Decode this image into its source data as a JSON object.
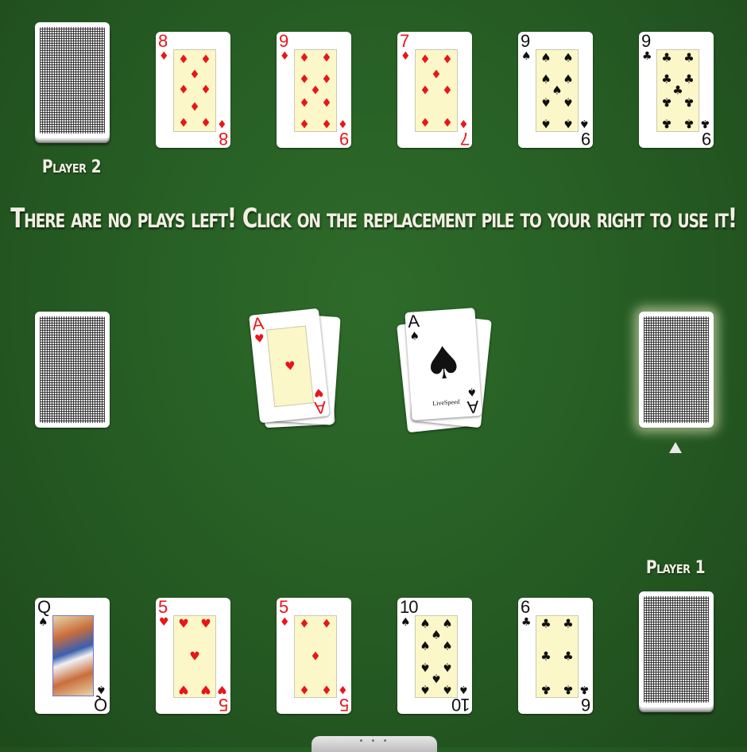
{
  "message": "There are no plays left! Click on the replacement pile to your right to use it!",
  "player2": {
    "label": "Player 2",
    "cards": [
      {
        "rank": "8",
        "suit": "♦",
        "color": "red"
      },
      {
        "rank": "9",
        "suit": "♦",
        "color": "red"
      },
      {
        "rank": "7",
        "suit": "♦",
        "color": "red"
      },
      {
        "rank": "9",
        "suit": "♠",
        "color": "black"
      },
      {
        "rank": "9",
        "suit": "♣",
        "color": "black"
      }
    ]
  },
  "player1": {
    "label": "Player 1",
    "cards": [
      {
        "rank": "Q",
        "suit": "♠",
        "color": "black"
      },
      {
        "rank": "5",
        "suit": "♥",
        "color": "red"
      },
      {
        "rank": "5",
        "suit": "♦",
        "color": "red"
      },
      {
        "rank": "10",
        "suit": "♠",
        "color": "black"
      },
      {
        "rank": "6",
        "suit": "♣",
        "color": "black"
      }
    ]
  },
  "center_piles": [
    {
      "rank": "A",
      "suit": "♥",
      "color": "red"
    },
    {
      "rank": "A",
      "suit": "♠",
      "color": "black",
      "brand": "LiveSpeed"
    }
  ],
  "replacement_pile_indicator": "▲"
}
